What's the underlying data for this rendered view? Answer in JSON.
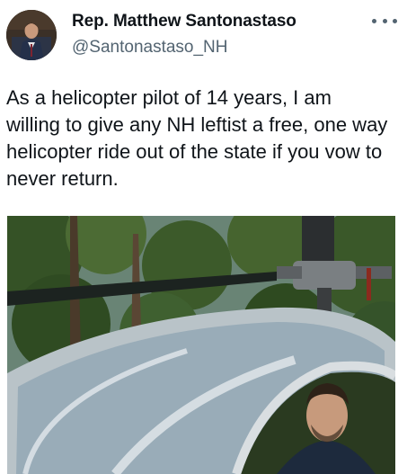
{
  "author": {
    "name": "Rep. Matthew Santonastaso",
    "handle": "@Santonastaso_NH"
  },
  "tweet": {
    "text": "As a helicopter pilot of 14 years, I am willing to give any NH leftist a free, one way helicopter ride out of the state if you vow to never return."
  },
  "icons": {
    "more": "more-options-icon"
  },
  "colors": {
    "text": "#0f1419",
    "secondary_text": "#536471"
  }
}
